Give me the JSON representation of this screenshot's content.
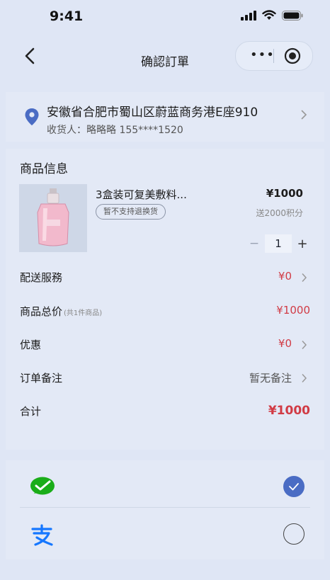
{
  "status_bar": {
    "time": "9:41"
  },
  "nav": {
    "title": "确認訂單"
  },
  "address": {
    "text": "安徽省合肥市蜀山区蔚蓝商务港E座910",
    "receiver": "收货人：略略略 155****1520"
  },
  "goods": {
    "section_title": "商品信息",
    "product": {
      "name": "3盒装可复美敷料...",
      "tag": "暂不支持退换货",
      "price": "¥1000",
      "points": "送2000积分",
      "quantity": "1"
    }
  },
  "rows": {
    "delivery": {
      "label": "配送服務",
      "value": "¥0"
    },
    "subtotal": {
      "label": "商品总价",
      "note": "(共1件商品)",
      "value": "¥1000"
    },
    "discount": {
      "label": "优惠",
      "value": "¥0"
    },
    "remark": {
      "label": "订单备注",
      "value": "暂无备注"
    },
    "total": {
      "label": "合计",
      "value": "¥1000"
    }
  },
  "payment": {
    "options": [
      {
        "icon": "wechat-pay-icon",
        "selected": true
      },
      {
        "icon": "alipay-icon",
        "selected": false
      }
    ]
  },
  "colors": {
    "accent": "#4a6cc4",
    "price_red": "#d13b45",
    "background": "#dfe6f5",
    "wechat": "#1aad19",
    "alipay": "#1677ff"
  }
}
